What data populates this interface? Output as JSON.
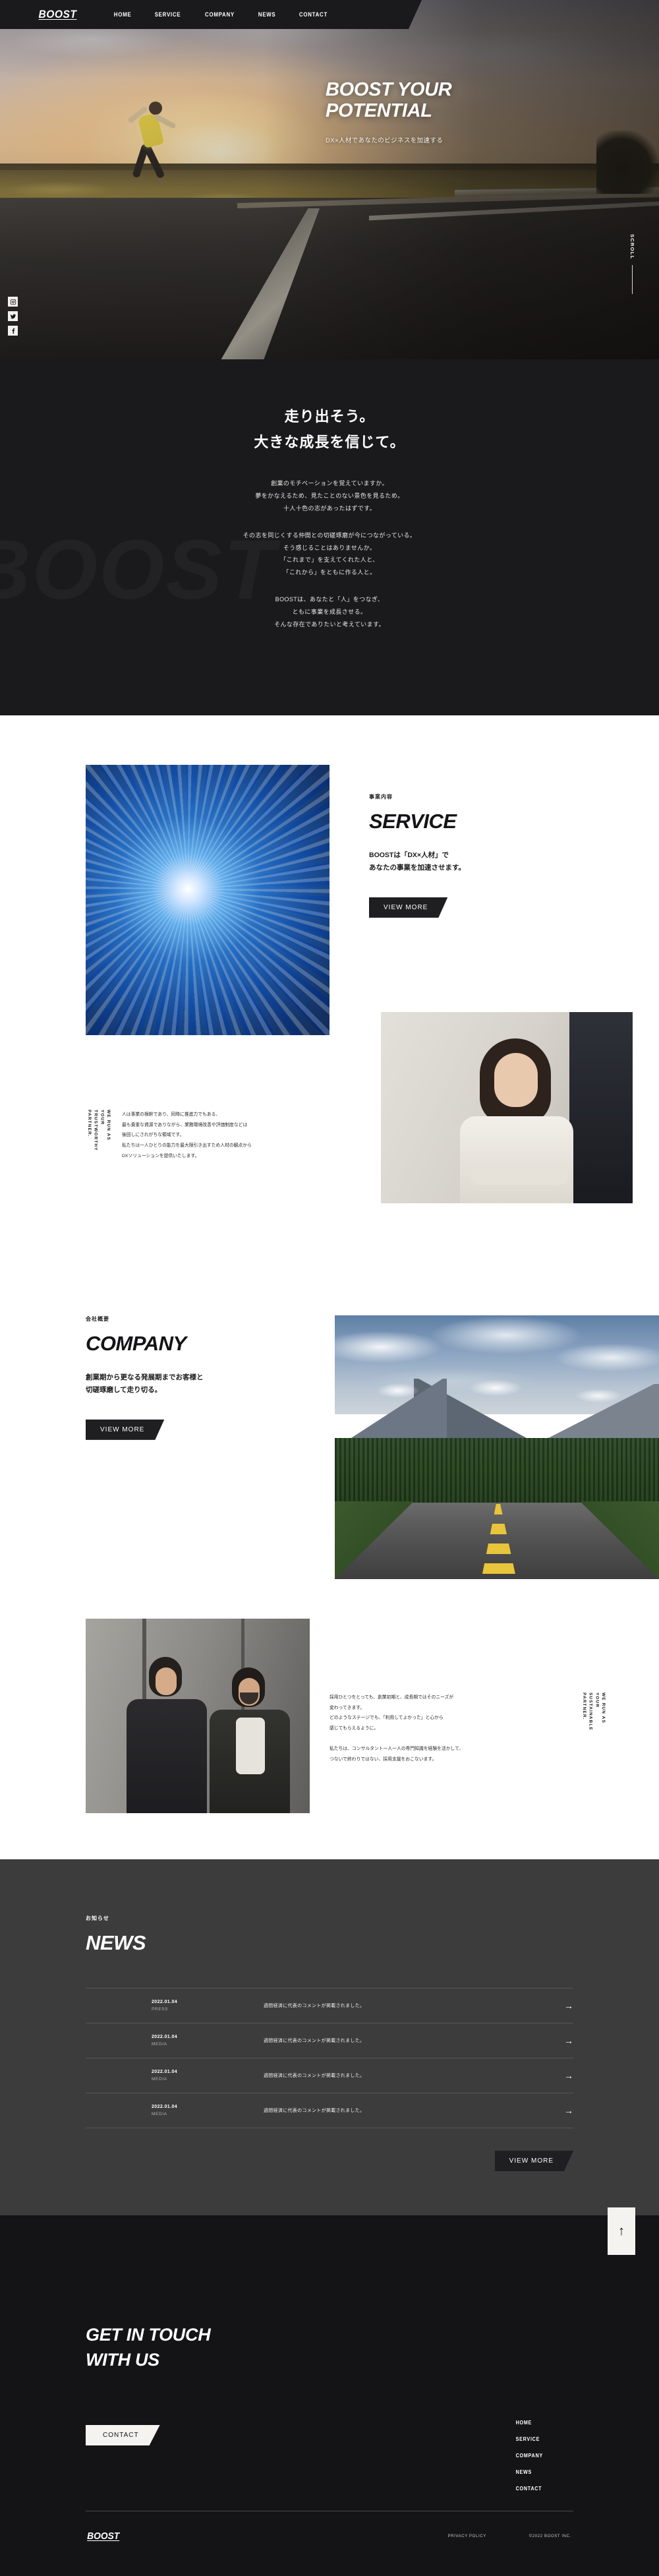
{
  "site": {
    "logo": "BOOST"
  },
  "nav": {
    "items": [
      "HOME",
      "SERVICE",
      "COMPANY",
      "NEWS",
      "CONTACT"
    ]
  },
  "hero": {
    "title_line1": "BOOST YOUR",
    "title_line2": "POTENTIAL",
    "subtitle": "DX×人材であなたのビジネスを加速する",
    "scroll": "SCROLL",
    "social": [
      "instagram-icon",
      "twitter-icon",
      "facebook-icon"
    ]
  },
  "message": {
    "watermark": "BOOST",
    "heading_line1": "走り出そう。",
    "heading_line2": "大きな成長を信じて。",
    "paragraph1": "創業のモチベーションを覚えていますか。\n夢をかなえるため、見たことのない景色を見るため。\n十人十色の志があったはずです。",
    "paragraph2": "その志を同じくする仲間との切磋琢磨が今につながっている。\nそう感じることはありませんか。\n「これまで」を支えてくれた人と、\n「これから」をともに作る人と。",
    "paragraph3": "BOOSTは、あなたと「人」をつなぎ、\nともに事業を成長させる。\nそんな存在でありたいと考えています。"
  },
  "service": {
    "label": "事業内容",
    "title": "SERVICE",
    "lead": "BOOSTは「DX×人材」で\nあなたの事業を加速させます。",
    "button": "VIEW MORE",
    "vertical_label": "WE RUN AS\nYOUR TRUSTWORTHY\nPARTNER.",
    "body": "人は事業の根幹であり、同時に推進力でもある、\n最も貴重な資源でありながら、業務環境改善や評価制度などは\n後回しにされがちな領域です。\n私たちは一人ひとりの能力を最大限引き出すため人材の観点から\nDXソリューションを提供いたします。"
  },
  "company": {
    "label": "会社概要",
    "title": "COMPANY",
    "lead": "創業期から更なる発展期までお客様と\n切磋琢磨して走り切る。",
    "button": "VIEW MORE",
    "vertical_label": "WE RUN AS\nYOUR SUSTAINABLE\nPARTNER.",
    "body": "採用ひとつをとっても、創業初期と、成長期ではそのニーズが\n変わってきます。\nどのようなステージでも、「利用してよかった」と心から\n感じてもらえるように。\n\n私たちは、コンサルタント一人一人の専門知識を経験を活かして、\nつないで終わりではない、採用支援をおこないます。"
  },
  "news": {
    "label": "お知らせ",
    "title": "NEWS",
    "button": "VIEW MORE",
    "arrow": "→",
    "items": [
      {
        "date": "2022.01.04",
        "category": "PRESS",
        "text": "週間経済に代表のコメントが掲載されました。"
      },
      {
        "date": "2022.01.04",
        "category": "MEDIA",
        "text": "週間経済に代表のコメントが掲載されました。"
      },
      {
        "date": "2022.01.04",
        "category": "MEDIA",
        "text": "週間経済に代表のコメントが掲載されました。"
      },
      {
        "date": "2022.01.04",
        "category": "MEDIA",
        "text": "週間経済に代表のコメントが掲載されました。"
      }
    ]
  },
  "footer": {
    "title_line1": "GET IN TOUCH",
    "title_line2": "WITH US",
    "contact_button": "CONTACT",
    "to_top": "↑",
    "nav": [
      "HOME",
      "SERVICE",
      "COMPANY",
      "NEWS",
      "CONTACT"
    ],
    "logo": "BOOST",
    "privacy": "PRIVACY POLICY",
    "copyright": "©2022 BOOST INC."
  },
  "colors": {
    "dark": "#1a1a1c",
    "news_bg": "#3c3c3c",
    "footer_bg": "#141417",
    "light": "#f5f3f0"
  }
}
